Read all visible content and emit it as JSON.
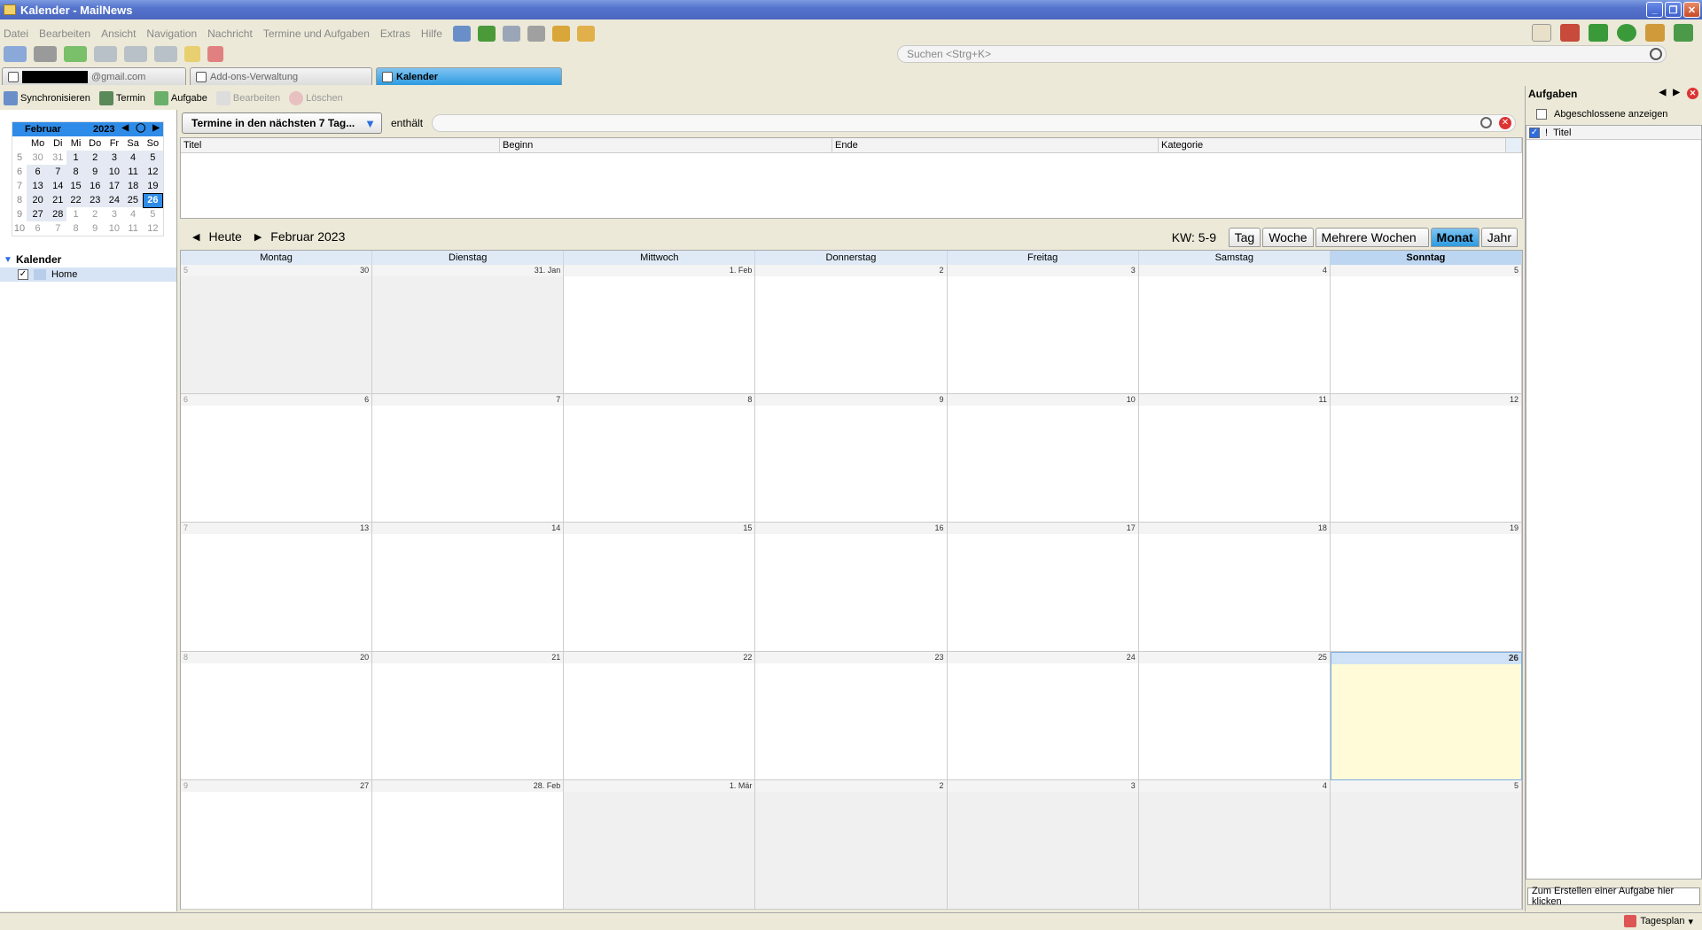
{
  "window": {
    "title": "Kalender - MailNews"
  },
  "menu": [
    "Datei",
    "Bearbeiten",
    "Ansicht",
    "Navigation",
    "Nachricht",
    "Termine und Aufgaben",
    "Extras",
    "Hilfe"
  ],
  "search": {
    "placeholder": "Suchen <Strg+K>"
  },
  "tabs": [
    {
      "label": "@gmail.com",
      "redacted": true
    },
    {
      "label": "Add-ons-Verwaltung"
    },
    {
      "label": "Kalender",
      "active": true
    }
  ],
  "caltoolbar": {
    "sync": "Synchronisieren",
    "termin": "Termin",
    "aufgabe": "Aufgabe",
    "bearbeiten": "Bearbeiten",
    "loeschen": "Löschen"
  },
  "minical": {
    "month": "Februar",
    "year": "2023",
    "weekdays": [
      "Mo",
      "Di",
      "Mi",
      "Do",
      "Fr",
      "Sa",
      "So"
    ],
    "weeks": [
      {
        "wk": "5",
        "days": [
          [
            "30",
            1
          ],
          [
            "31",
            1
          ],
          [
            "1",
            0
          ],
          [
            "2",
            0
          ],
          [
            "3",
            0
          ],
          [
            "4",
            0
          ],
          [
            "5",
            0
          ]
        ]
      },
      {
        "wk": "6",
        "days": [
          [
            "6",
            0
          ],
          [
            "7",
            0
          ],
          [
            "8",
            0
          ],
          [
            "9",
            0
          ],
          [
            "10",
            0
          ],
          [
            "11",
            0
          ],
          [
            "12",
            0
          ]
        ]
      },
      {
        "wk": "7",
        "days": [
          [
            "13",
            0
          ],
          [
            "14",
            0
          ],
          [
            "15",
            0
          ],
          [
            "16",
            0
          ],
          [
            "17",
            0
          ],
          [
            "18",
            0
          ],
          [
            "19",
            0
          ]
        ]
      },
      {
        "wk": "8",
        "days": [
          [
            "20",
            0
          ],
          [
            "21",
            0
          ],
          [
            "22",
            0
          ],
          [
            "23",
            0
          ],
          [
            "24",
            0
          ],
          [
            "25",
            0
          ],
          [
            "26",
            2
          ]
        ]
      },
      {
        "wk": "9",
        "days": [
          [
            "27",
            0
          ],
          [
            "28",
            0
          ],
          [
            "1",
            1
          ],
          [
            "2",
            1
          ],
          [
            "3",
            1
          ],
          [
            "4",
            1
          ],
          [
            "5",
            1
          ]
        ]
      },
      {
        "wk": "10",
        "days": [
          [
            "6",
            1
          ],
          [
            "7",
            1
          ],
          [
            "8",
            1
          ],
          [
            "9",
            1
          ],
          [
            "10",
            1
          ],
          [
            "11",
            1
          ],
          [
            "12",
            1
          ]
        ]
      }
    ]
  },
  "calendars": {
    "header": "Kalender",
    "items": [
      "Home"
    ]
  },
  "filter": {
    "dropdown": "Termine in den nächsten 7 Tag...",
    "label": "enthält"
  },
  "eventlist": {
    "columns": [
      "Titel",
      "Beginn",
      "Ende",
      "Kategorie"
    ]
  },
  "monthview": {
    "today": "Heute",
    "title": "Februar 2023",
    "kw": "KW: 5-9",
    "views": [
      "Tag",
      "Woche",
      "Mehrere Wochen",
      "Monat",
      "Jahr"
    ],
    "activeView": "Monat",
    "dayheads": [
      "Montag",
      "Dienstag",
      "Mittwoch",
      "Donnerstag",
      "Freitag",
      "Samstag",
      "Sonntag"
    ],
    "weeks": [
      {
        "wk": "5",
        "days": [
          [
            "30",
            1
          ],
          [
            "31. Jan",
            1
          ],
          [
            "1. Feb",
            0
          ],
          [
            "2",
            0
          ],
          [
            "3",
            0
          ],
          [
            "4",
            0
          ],
          [
            "5",
            0
          ]
        ]
      },
      {
        "wk": "6",
        "days": [
          [
            "6",
            0
          ],
          [
            "7",
            0
          ],
          [
            "8",
            0
          ],
          [
            "9",
            0
          ],
          [
            "10",
            0
          ],
          [
            "11",
            0
          ],
          [
            "12",
            0
          ]
        ]
      },
      {
        "wk": "7",
        "days": [
          [
            "13",
            0
          ],
          [
            "14",
            0
          ],
          [
            "15",
            0
          ],
          [
            "16",
            0
          ],
          [
            "17",
            0
          ],
          [
            "18",
            0
          ],
          [
            "19",
            0
          ]
        ]
      },
      {
        "wk": "8",
        "days": [
          [
            "20",
            0
          ],
          [
            "21",
            0
          ],
          [
            "22",
            0
          ],
          [
            "23",
            0
          ],
          [
            "24",
            0
          ],
          [
            "25",
            0
          ],
          [
            "26",
            2
          ]
        ]
      },
      {
        "wk": "9",
        "days": [
          [
            "27",
            0
          ],
          [
            "28. Feb",
            0
          ],
          [
            "1. Mär",
            1
          ],
          [
            "2",
            1
          ],
          [
            "3",
            1
          ],
          [
            "4",
            1
          ],
          [
            "5",
            1
          ]
        ]
      }
    ]
  },
  "tasks": {
    "header": "Aufgaben",
    "showDone": "Abgeschlossene anzeigen",
    "colTitle": "Titel",
    "newTask": "Zum Erstellen einer Aufgabe hier klicken"
  },
  "statusbar": {
    "tagesplan": "Tagesplan"
  }
}
